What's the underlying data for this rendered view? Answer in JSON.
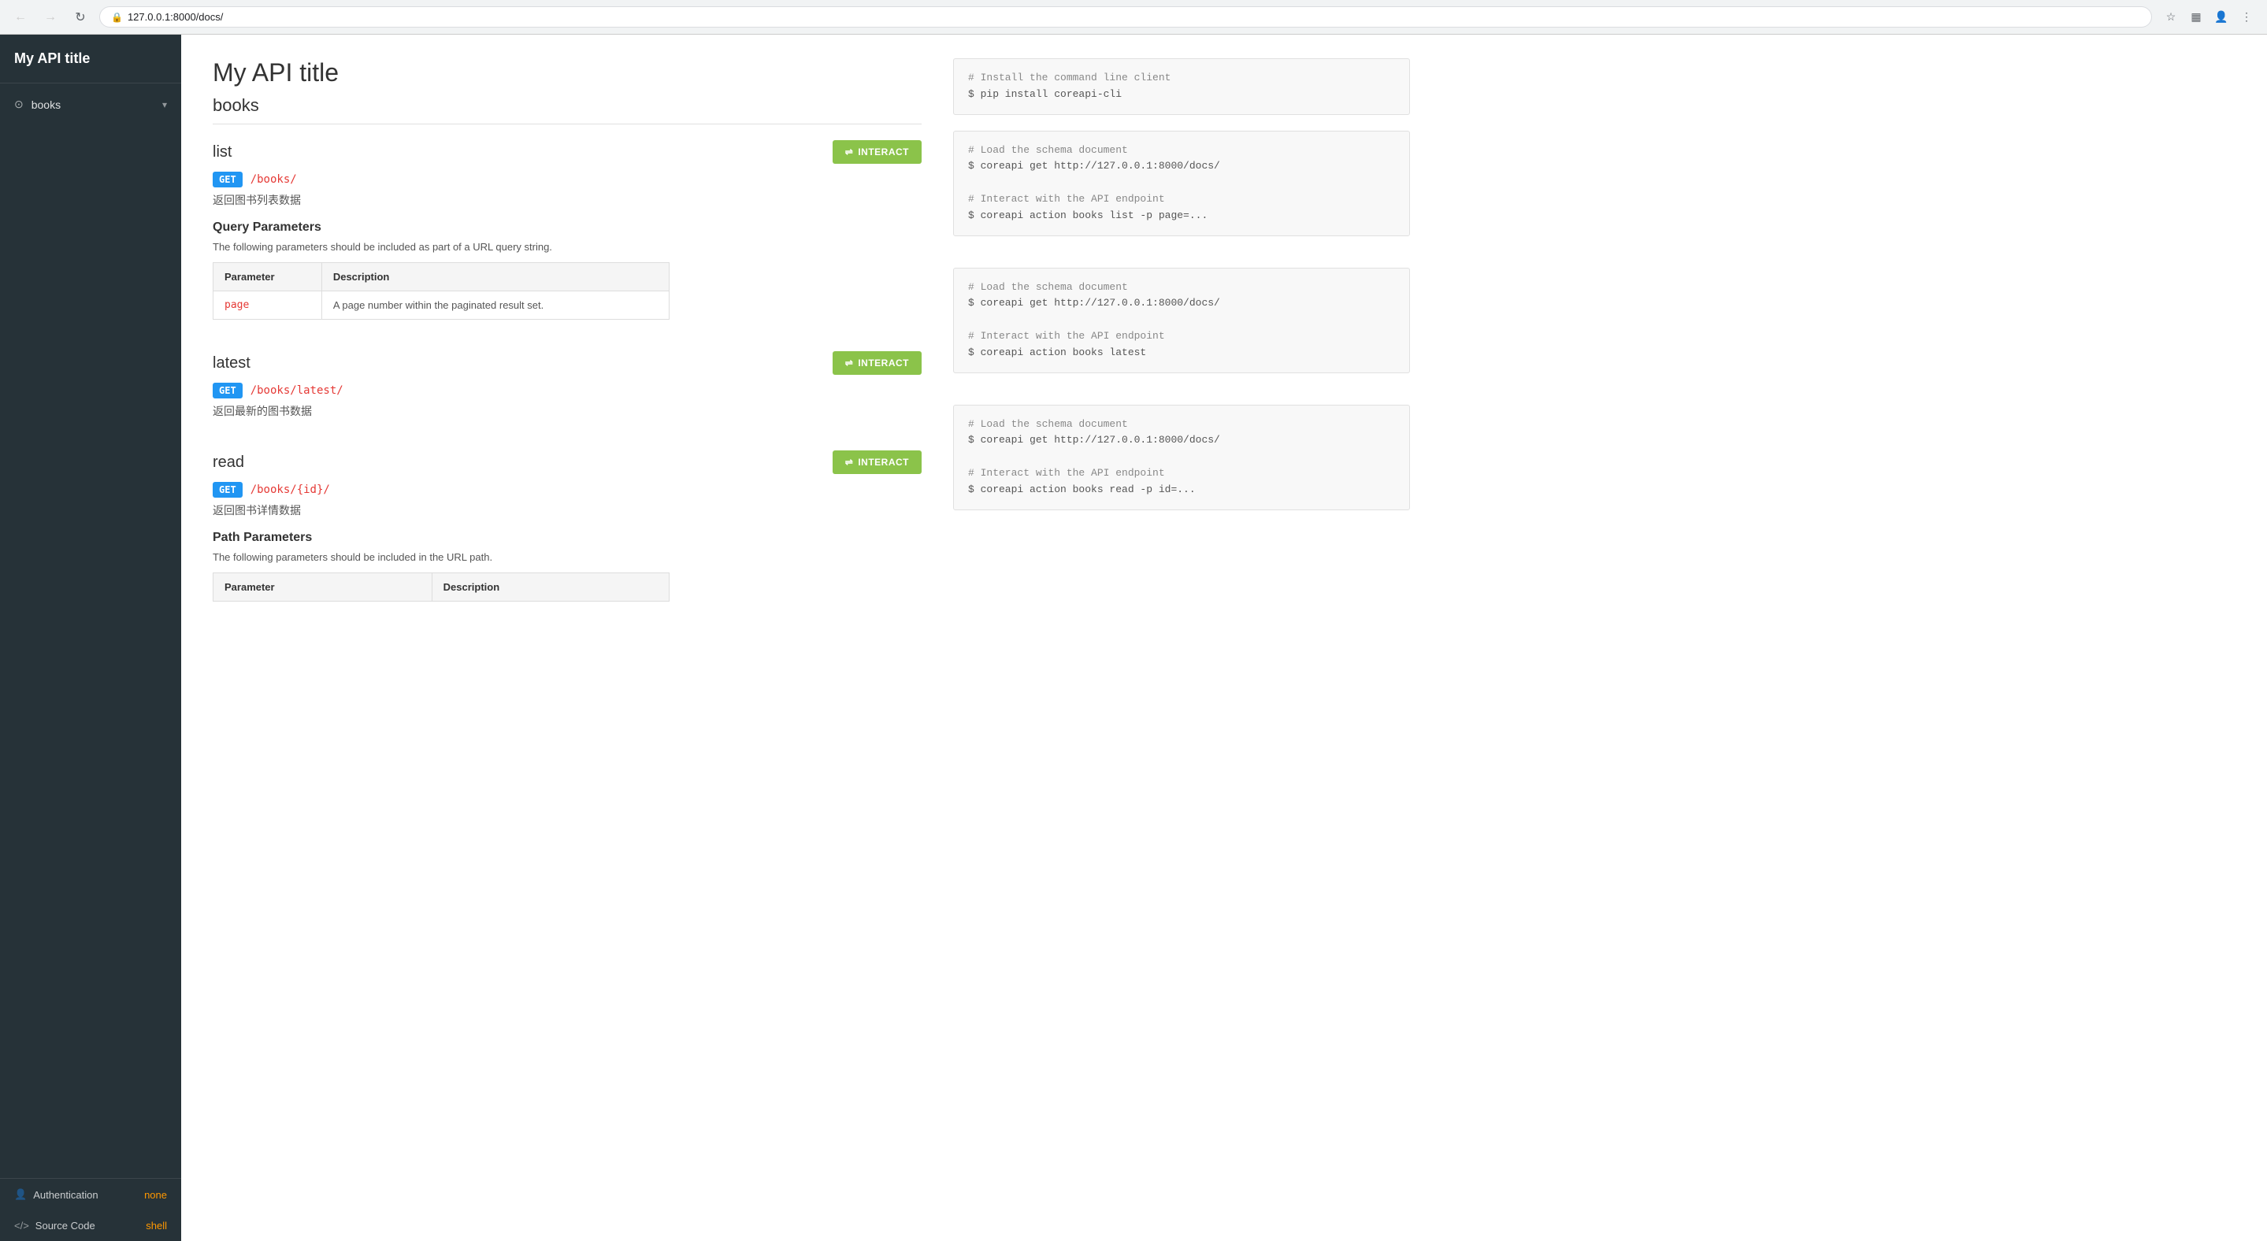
{
  "browser": {
    "url": "127.0.0.1:8000/docs/",
    "url_icon": "🔒"
  },
  "sidebar": {
    "title": "My API title",
    "nav_items": [
      {
        "icon": "⊙",
        "label": "books",
        "has_chevron": true
      }
    ],
    "footer_items": [
      {
        "icon": "👤",
        "label": "Authentication",
        "badge": "none",
        "badge_type": "none"
      },
      {
        "icon": "</>",
        "label": "Source Code",
        "badge": "shell",
        "badge_type": "shell"
      }
    ]
  },
  "main": {
    "page_title": "My API title",
    "install_code": "# Install the command line client\n$ pip install coreapi-cli",
    "books_section": {
      "title": "books",
      "endpoints": [
        {
          "id": "list",
          "title": "list",
          "method": "GET",
          "path": "/books/",
          "description": "返回图书列表数据",
          "interact_label": "⇌ INTERACT",
          "has_query_params": true,
          "query_params_title": "Query Parameters",
          "query_params_desc": "The following parameters should be included as part of a URL query string.",
          "params_table": {
            "headers": [
              "Parameter",
              "Description"
            ],
            "rows": [
              {
                "name": "page",
                "description": "A page number within the paginated result set."
              }
            ]
          },
          "code": "# Load the schema document\n$ coreapi get http://127.0.0.1:8000/docs/\n\n# Interact with the API endpoint\n$ coreapi action books list -p page=..."
        },
        {
          "id": "latest",
          "title": "latest",
          "method": "GET",
          "path": "/books/latest/",
          "description": "返回最新的图书数据",
          "interact_label": "⇌ INTERACT",
          "has_query_params": false,
          "code": "# Load the schema document\n$ coreapi get http://127.0.0.1:8000/docs/\n\n# Interact with the API endpoint\n$ coreapi action books latest"
        },
        {
          "id": "read",
          "title": "read",
          "method": "GET",
          "path": "/books/{id}/",
          "description": "返回图书详情数据",
          "interact_label": "⇌ INTERACT",
          "has_path_params": true,
          "path_params_title": "Path Parameters",
          "path_params_desc": "The following parameters should be included in the URL path.",
          "params_table": {
            "headers": [
              "Parameter",
              "Description"
            ],
            "rows": []
          },
          "code": "# Load the schema document\n$ coreapi get http://127.0.0.1:8000/docs/\n\n# Interact with the API endpoint\n$ coreapi action books read -p id=..."
        }
      ]
    }
  }
}
